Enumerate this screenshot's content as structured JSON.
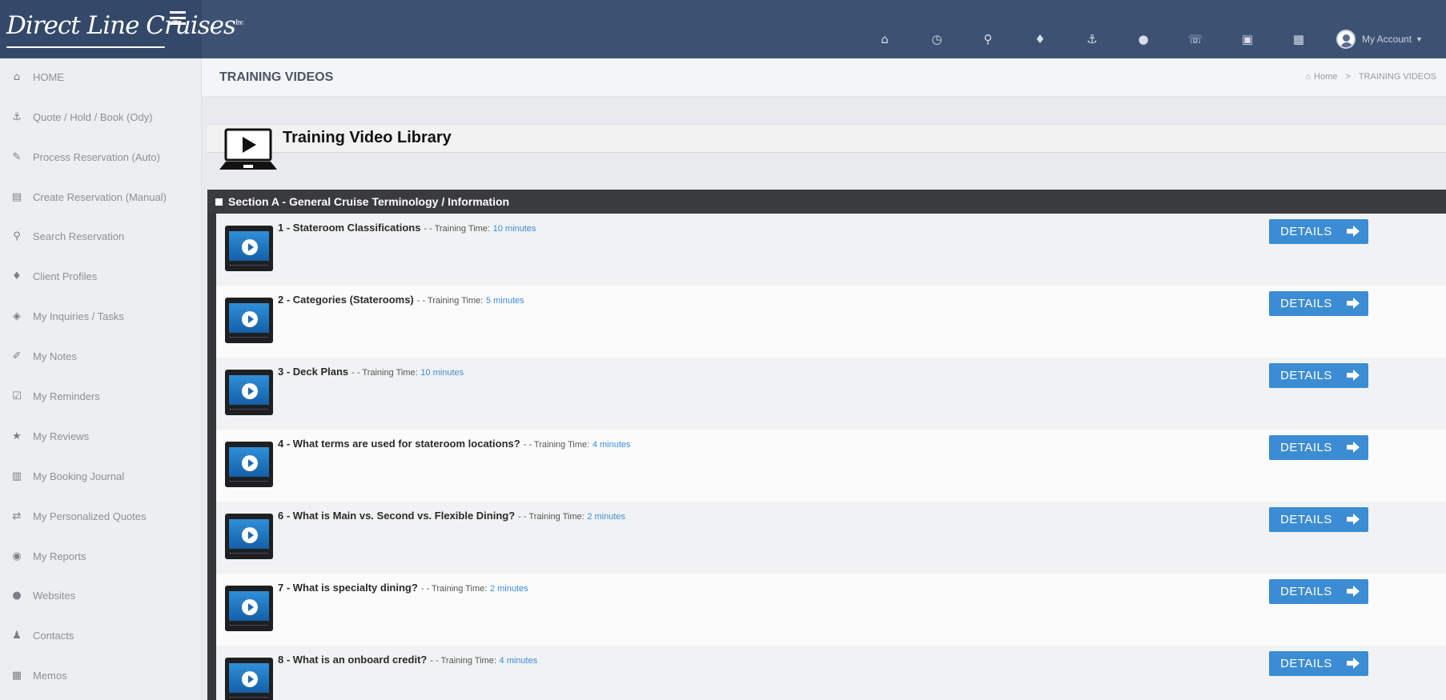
{
  "app": {
    "logo_text": "Direct Line Cruises",
    "logo_mark": "Inc"
  },
  "topbar": {
    "icons": [
      {
        "name": "home-icon",
        "glyph": "⌂"
      },
      {
        "name": "clock-icon",
        "glyph": "◷"
      },
      {
        "name": "search-icon",
        "glyph": "⚲"
      },
      {
        "name": "person-icon",
        "glyph": "♦"
      },
      {
        "name": "anchor-icon",
        "glyph": "⚓"
      },
      {
        "name": "globe-icon",
        "glyph": "●"
      },
      {
        "name": "phone-icon",
        "glyph": "☏"
      },
      {
        "name": "window-icon",
        "glyph": "▣"
      },
      {
        "name": "calendar-icon",
        "glyph": "▦"
      }
    ],
    "account_label": "My Account"
  },
  "sidebar": {
    "items": [
      {
        "label": "HOME",
        "icon": "home-icon",
        "glyph": "⌂"
      },
      {
        "label": "Quote / Hold / Book (Ody)",
        "icon": "anchor-icon",
        "glyph": "⚓"
      },
      {
        "label": "Process Reservation (Auto)",
        "icon": "pencil-icon",
        "glyph": "✎"
      },
      {
        "label": "Create Reservation (Manual)",
        "icon": "file-icon",
        "glyph": "▤"
      },
      {
        "label": "Search Reservation",
        "icon": "search-icon",
        "glyph": "⚲"
      },
      {
        "label": "Client Profiles",
        "icon": "person-icon",
        "glyph": "♦"
      },
      {
        "label": "My Inquiries / Tasks",
        "icon": "tag-icon",
        "glyph": "◈"
      },
      {
        "label": "My Notes",
        "icon": "paperclip-icon",
        "glyph": "✐"
      },
      {
        "label": "My Reminders",
        "icon": "checkbox-icon",
        "glyph": "☑"
      },
      {
        "label": "My Reviews",
        "icon": "star-icon",
        "glyph": "★"
      },
      {
        "label": "My Booking Journal",
        "icon": "book-icon",
        "glyph": "▥"
      },
      {
        "label": "My Personalized Quotes",
        "icon": "exchange-icon",
        "glyph": "⇄"
      },
      {
        "label": "My Reports",
        "icon": "dashboard-icon",
        "glyph": "◉"
      },
      {
        "label": "Websites",
        "icon": "globe-icon",
        "glyph": "●"
      },
      {
        "label": "Contacts",
        "icon": "user-icon",
        "glyph": "♟"
      },
      {
        "label": "Memos",
        "icon": "memo-icon",
        "glyph": "▦"
      }
    ]
  },
  "header": {
    "title": "TRAINING VIDEOS",
    "breadcrumb_home": "Home",
    "breadcrumb_sep": ">",
    "breadcrumb_current": "TRAINING VIDEOS"
  },
  "library": {
    "title": "Training Video Library"
  },
  "section": {
    "title": "Section A - General Cruise Terminology / Information"
  },
  "videos": [
    {
      "title": "1 - Stateroom Classifications",
      "meta": "- -  Training Time:",
      "time": "10 minutes"
    },
    {
      "title": "2 - Categories (Staterooms)",
      "meta": "- -  Training Time:",
      "time": "5 minutes"
    },
    {
      "title": "3 - Deck Plans",
      "meta": "- -  Training Time:",
      "time": "10 minutes"
    },
    {
      "title": "4 - What terms are used for stateroom locations?",
      "meta": "- -  Training Time:",
      "time": "4 minutes"
    },
    {
      "title": "6 - What is Main vs. Second vs. Flexible Dining?",
      "meta": "- -  Training Time:",
      "time": "2 minutes"
    },
    {
      "title": "7 - What is specialty dining?",
      "meta": "- -  Training Time:",
      "time": "2 minutes"
    },
    {
      "title": "8 - What is an onboard credit?",
      "meta": "- -  Training Time:",
      "time": "4 minutes"
    }
  ],
  "details_label": "DETAILS",
  "colors": {
    "topbar": "#3d5273",
    "section_bar": "#3a3b3e",
    "details_button": "#3c8cd3",
    "time_link": "#3b8ed8"
  }
}
